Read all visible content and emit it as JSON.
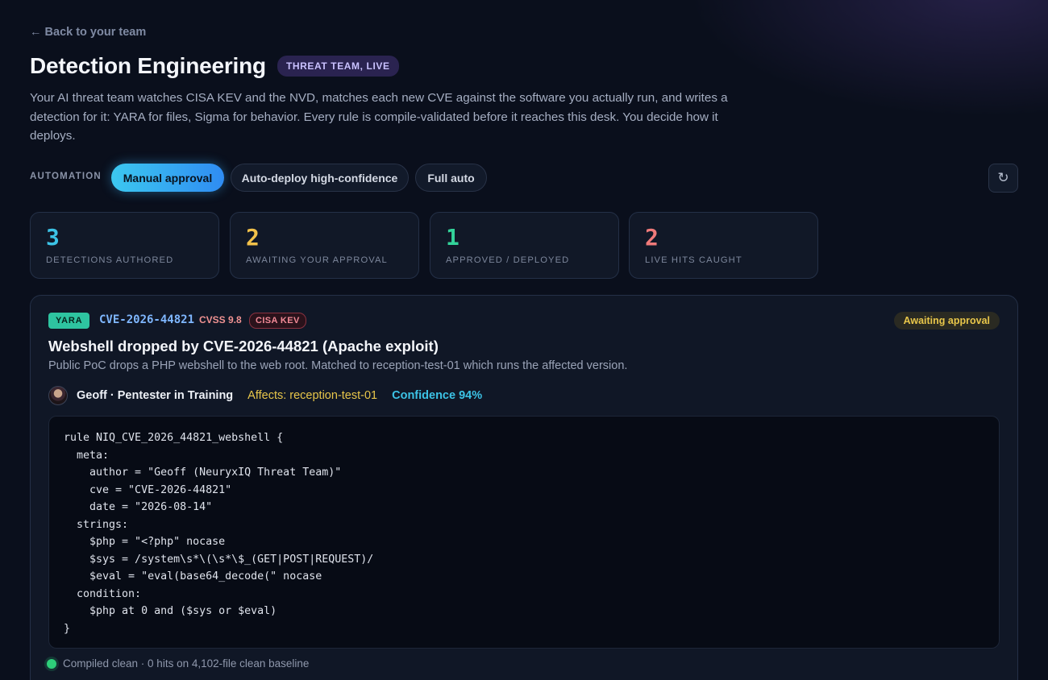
{
  "nav": {
    "back_label": "← Back to your team"
  },
  "header": {
    "title": "Detection Engineering",
    "badge": "THREAT TEAM, LIVE",
    "description": "Your AI threat team watches CISA KEV and the NVD, matches each new CVE against the software you actually run, and writes a detection for it: YARA for files, Sigma for behavior. Every rule is compile-validated before it reaches this desk. You decide how it deploys."
  },
  "automation": {
    "label": "AUTOMATION",
    "options": [
      "Manual approval",
      "Auto-deploy high-confidence",
      "Full auto"
    ],
    "selected": "Manual approval",
    "refresh_icon": "↻"
  },
  "stats": [
    {
      "value": "3",
      "label": "DETECTIONS AUTHORED",
      "color": "#3cc3e6"
    },
    {
      "value": "2",
      "label": "AWAITING YOUR APPROVAL",
      "color": "#f2c14a"
    },
    {
      "value": "1",
      "label": "APPROVED / DEPLOYED",
      "color": "#33d39a"
    },
    {
      "value": "2",
      "label": "LIVE HITS CAUGHT",
      "color": "#f07a7a"
    }
  ],
  "detection": {
    "type": "YARA",
    "cve": "CVE-2026-44821",
    "cvss": "CVSS 9.8",
    "kev": "CISA KEV",
    "status": "Awaiting approval",
    "title": "Webshell dropped by CVE-2026-44821 (Apache exploit)",
    "summary": "Public PoC drops a PHP webshell to the web root. Matched to reception-test-01 which runs the affected version.",
    "author": "Geoff · Pentester in Training",
    "affects": "Affects: reception-test-01",
    "confidence": "Confidence 94%",
    "rule": "rule NIQ_CVE_2026_44821_webshell {\n  meta:\n    author = \"Geoff (NeuryxIQ Threat Team)\"\n    cve = \"CVE-2026-44821\"\n    date = \"2026-08-14\"\n  strings:\n    $php = \"<?php\" nocase\n    $sys = /system\\s*\\(\\s*\\$_(GET|POST|REQUEST)/\n    $eval = \"eval(base64_decode(\" nocase\n  condition:\n    $php at 0 and ($sys or $eval)\n}",
    "compile_status": "Compiled clean · 0 hits on 4,102-file clean baseline"
  }
}
